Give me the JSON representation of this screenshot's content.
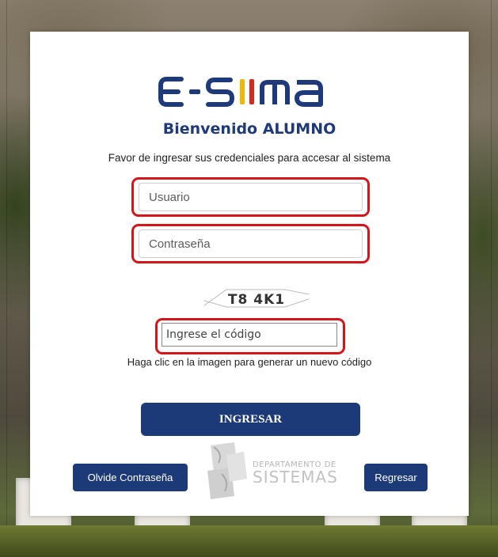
{
  "logo": {
    "text": "E-SIIMA"
  },
  "header": {
    "welcome": "Bienvenido ALUMNO",
    "subtitle": "Favor de ingresar sus credenciales para accesar al sistema"
  },
  "form": {
    "username_placeholder": "Usuario",
    "password_placeholder": "Contraseña",
    "captcha_text": "T8 4K1",
    "code_placeholder": "Ingrese el código",
    "captcha_hint": "Haga clic en la imagen para generar un nuevo código",
    "submit_label": "INGRESAR"
  },
  "footer": {
    "forgot_label": "Olvide Contraseña",
    "back_label": "Regresar",
    "dept_line1": "DEPARTAMENTO DE",
    "dept_line2": "SISTEMAS"
  },
  "colors": {
    "brand_blue": "#1d3a78",
    "highlight_red": "#d7141a",
    "logo_yellow": "#f2b705",
    "logo_red": "#d52b1e"
  }
}
